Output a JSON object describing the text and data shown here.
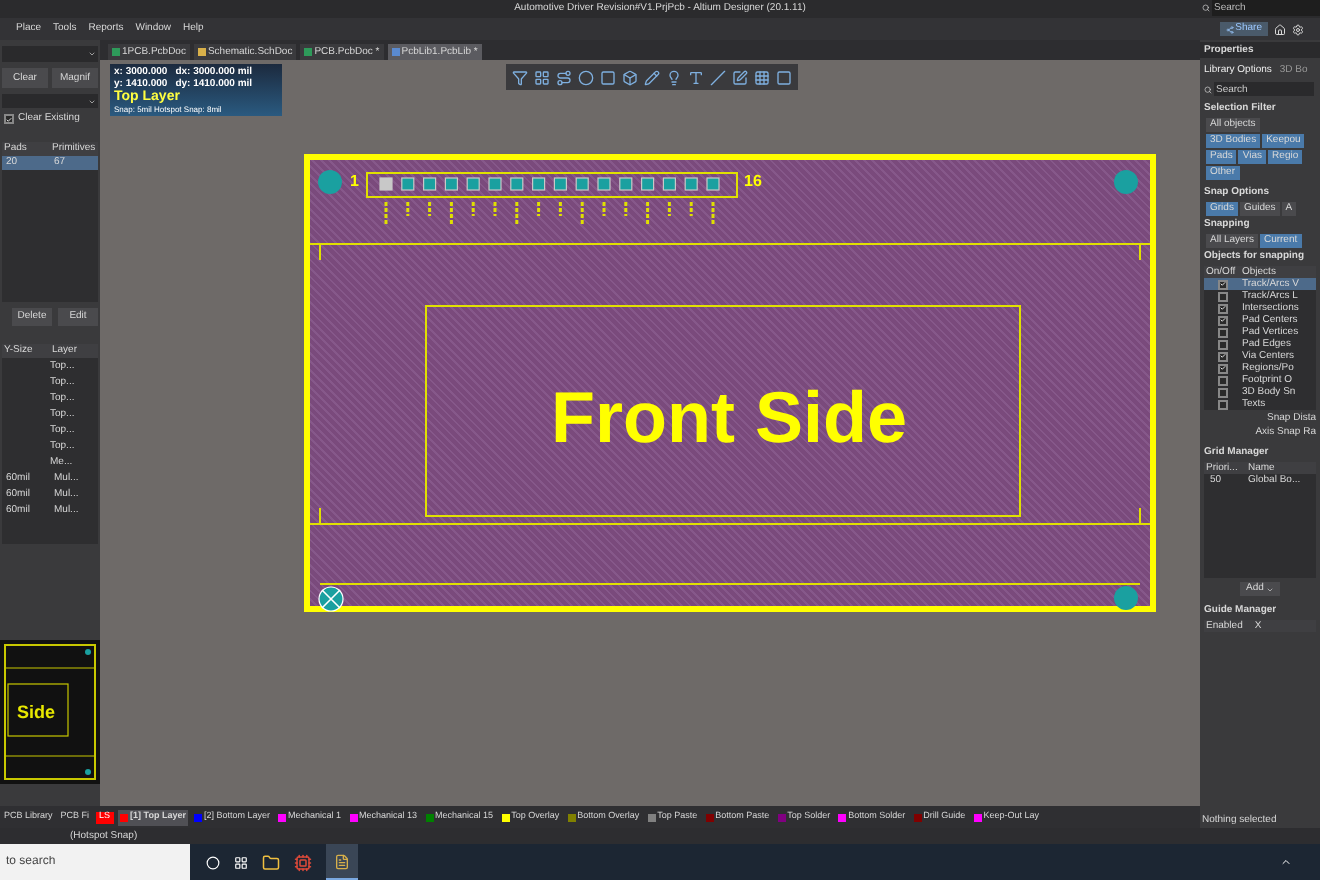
{
  "window": {
    "title": "Automotive Driver Revision#V1.PrjPcb - Altium Designer (20.1.11)",
    "search_placeholder": "Search"
  },
  "menu": [
    "Place",
    "Tools",
    "Reports",
    "Window",
    "Help"
  ],
  "share": "Share",
  "document_tabs": [
    {
      "label": "1PCB.PcbDoc",
      "kind": "pcb",
      "selected": false
    },
    {
      "label": "Schematic.SchDoc",
      "kind": "sch",
      "selected": false
    },
    {
      "label": "PCB.PcbDoc *",
      "kind": "pcb",
      "selected": false
    },
    {
      "label": "PcbLib1.PcbLib *",
      "kind": "lib",
      "selected": true
    }
  ],
  "left_panel": {
    "buttons_top": [
      "Clear",
      "Magnif"
    ],
    "clear_existing": {
      "label": "Clear Existing",
      "checked": true
    },
    "table_1": {
      "columns": [
        "Pads",
        "Primitives"
      ],
      "rows": [
        {
          "cells": [
            "20",
            "67"
          ],
          "selected": true
        }
      ]
    },
    "buttons_bottom": [
      "Delete",
      "Edit"
    ],
    "table_2": {
      "columns": [
        "Y-Size",
        "Layer"
      ],
      "rows": [
        {
          "cells": [
            "",
            "Top..."
          ]
        },
        {
          "cells": [
            "",
            "Top..."
          ]
        },
        {
          "cells": [
            "",
            "Top..."
          ]
        },
        {
          "cells": [
            "",
            "Top..."
          ]
        },
        {
          "cells": [
            "",
            "Top..."
          ]
        },
        {
          "cells": [
            "",
            "Top..."
          ]
        },
        {
          "cells": [
            "",
            "Me..."
          ]
        },
        {
          "cells": [
            "60mil",
            "Mul..."
          ]
        },
        {
          "cells": [
            "60mil",
            "Mul..."
          ]
        },
        {
          "cells": [
            "60mil",
            "Mul..."
          ]
        }
      ]
    },
    "preview_label": "Side"
  },
  "canvas": {
    "info": {
      "x": "x: 3000.000",
      "dx": "dx: 3000.000 mil",
      "y": "y: 1410.000",
      "dy": "dy: 1410.000 mil",
      "layer": "Top Layer",
      "snap": "Snap: 5mil Hotspot Snap: 8mil"
    },
    "board": {
      "pin_first": "1",
      "pin_last": "16",
      "label": "Front Side"
    }
  },
  "layer_bar": {
    "panel_tabs": [
      "PCB Library",
      "PCB Fi"
    ],
    "layer_set": "LS",
    "layers": [
      {
        "label": "[1] Top Layer",
        "color": "#ff0000",
        "selected": true
      },
      {
        "label": "[2] Bottom Layer",
        "color": "#0000ff",
        "selected": false
      },
      {
        "label": "Mechanical 1",
        "color": "#ff00ff",
        "selected": false
      },
      {
        "label": "Mechanical 13",
        "color": "#ff00ff",
        "selected": false
      },
      {
        "label": "Mechanical 15",
        "color": "#008000",
        "selected": false
      },
      {
        "label": "Top Overlay",
        "color": "#ffff00",
        "selected": false
      },
      {
        "label": "Bottom Overlay",
        "color": "#808000",
        "selected": false
      },
      {
        "label": "Top Paste",
        "color": "#808080",
        "selected": false
      },
      {
        "label": "Bottom Paste",
        "color": "#800000",
        "selected": false
      },
      {
        "label": "Top Solder",
        "color": "#800080",
        "selected": false
      },
      {
        "label": "Bottom Solder",
        "color": "#ff00ff",
        "selected": false
      },
      {
        "label": "Drill Guide",
        "color": "#800000",
        "selected": false
      },
      {
        "label": "Keep-Out Lay",
        "color": "#ff00ff",
        "selected": false
      }
    ]
  },
  "properties": {
    "title": "Properties",
    "tabs": [
      {
        "label": "Library Options",
        "selected": true
      },
      {
        "label": "3D Bo",
        "selected": false
      }
    ],
    "search_placeholder": "Search",
    "selection_filter": {
      "title": "Selection Filter",
      "buttons": [
        {
          "label": "All objects",
          "on": false
        },
        {
          "label": "3D Bodies",
          "on": true
        },
        {
          "label": "Keepou",
          "on": true
        },
        {
          "label": "Pads",
          "on": true
        },
        {
          "label": "Vias",
          "on": true
        },
        {
          "label": "Regio",
          "on": true
        },
        {
          "label": "Other",
          "on": true
        }
      ]
    },
    "snap_options": {
      "title": "Snap Options",
      "tabs": [
        {
          "label": "Grids",
          "selected": true
        },
        {
          "label": "Guides",
          "selected": false
        },
        {
          "label": "A",
          "selected": false
        }
      ],
      "snapping_title": "Snapping",
      "snapping": [
        {
          "label": "All Layers",
          "selected": false
        },
        {
          "label": "Current",
          "selected": true
        }
      ],
      "objects_title": "Objects for snapping",
      "columns": [
        "On/Off",
        "Objects"
      ],
      "objects": [
        {
          "label": "Track/Arcs V",
          "checked": true,
          "selected": true
        },
        {
          "label": "Track/Arcs L",
          "checked": false,
          "selected": false
        },
        {
          "label": "Intersections",
          "checked": true,
          "selected": false
        },
        {
          "label": "Pad Centers",
          "checked": true,
          "selected": false
        },
        {
          "label": "Pad Vertices",
          "checked": false,
          "selected": false
        },
        {
          "label": "Pad Edges",
          "checked": false,
          "selected": false
        },
        {
          "label": "Via Centers",
          "checked": true,
          "selected": false
        },
        {
          "label": "Regions/Po",
          "checked": true,
          "selected": false
        },
        {
          "label": "Footprint O",
          "checked": false,
          "selected": false
        },
        {
          "label": "3D Body Sn",
          "checked": false,
          "selected": false
        },
        {
          "label": "Texts",
          "checked": false,
          "selected": false
        }
      ],
      "snap_distance": "Snap Dista",
      "axis_snap": "Axis Snap Ra"
    },
    "grid_manager": {
      "title": "Grid Manager",
      "columns": [
        "Priori...",
        "Name"
      ],
      "rows": [
        {
          "cells": [
            "50",
            "Global Bo..."
          ]
        }
      ],
      "add": "Add"
    },
    "guide_manager": {
      "title": "Guide Manager",
      "columns": [
        "Enabled",
        "X"
      ]
    },
    "status": "Nothing selected"
  },
  "status_bar": "(Hotspot Snap)",
  "taskbar": {
    "search_placeholder": "to search"
  }
}
